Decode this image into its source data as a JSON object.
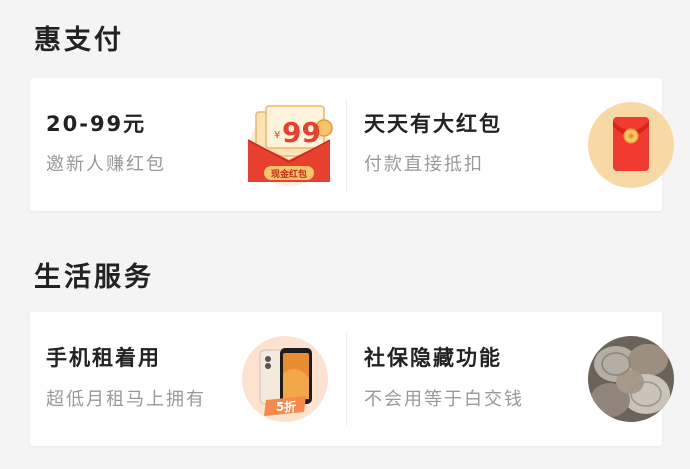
{
  "sections": [
    {
      "title": "惠支付",
      "items": [
        {
          "title": "20-99元",
          "subtitle": "邀新人赚红包",
          "icon": "red-envelope-cash-icon",
          "badge_value": "99",
          "badge_currency": "¥",
          "badge_label": "现金红包"
        },
        {
          "title": "天天有大红包",
          "subtitle": "付款直接抵扣",
          "icon": "red-packet-icon"
        }
      ]
    },
    {
      "title": "生活服务",
      "items": [
        {
          "title": "手机租着用",
          "subtitle": "超低月租马上拥有",
          "icon": "phone-rental-icon",
          "badge_label": "5折"
        },
        {
          "title": "社保隐藏功能",
          "subtitle": "不会用等于白交钱",
          "icon": "coins-icon"
        }
      ]
    }
  ],
  "colors": {
    "accent_red": "#f04a3a",
    "gold": "#f6c46a",
    "text_primary": "#222222",
    "text_secondary": "#999999",
    "badge_orange": "#f58a4a"
  }
}
